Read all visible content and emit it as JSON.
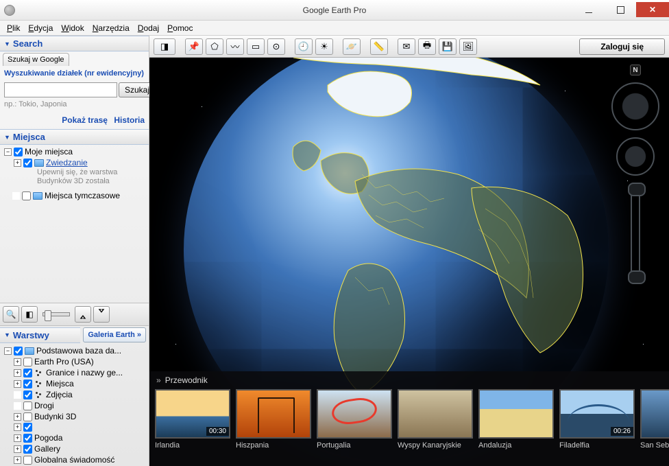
{
  "window": {
    "title": "Google Earth Pro"
  },
  "menu": {
    "file": "Plik",
    "edit": "Edycja",
    "view": "Widok",
    "tools": "Narzędzia",
    "add": "Dodaj",
    "help": "Pomoc"
  },
  "toolbar": {
    "login": "Zaloguj się"
  },
  "search": {
    "header": "Search",
    "tab_google": "Szukaj w Google",
    "tab_parcels": "Wyszukiwanie działek (nr ewidencyjny)",
    "button": "Szukaj",
    "hint": "np.: Tokio, Japonia",
    "route": "Pokaż trasę",
    "history": "Historia",
    "value": ""
  },
  "places": {
    "header": "Miejsca",
    "my_places": "Moje miejsca",
    "sightseeing": "Zwiedzanie",
    "note1": "Upewnij się, że warstwa",
    "note2": "Budynków 3D została",
    "temp": "Miejsca tymczasowe"
  },
  "layers": {
    "header": "Warstwy",
    "gallery_btn": "Galeria Earth »",
    "items": [
      {
        "label": "Podstawowa baza da...",
        "checked": true,
        "icon": "folder",
        "exp": "minus",
        "indent": 0
      },
      {
        "label": "Earth Pro (USA)",
        "checked": false,
        "icon": "none",
        "exp": "plus",
        "indent": 1
      },
      {
        "label": "Granice i nazwy ge...",
        "checked": true,
        "icon": "dots",
        "exp": "plus",
        "indent": 1
      },
      {
        "label": "Miejsca",
        "checked": true,
        "icon": "dots",
        "exp": "plus",
        "indent": 1
      },
      {
        "label": "Zdjęcia",
        "checked": true,
        "icon": "dots",
        "exp": "blank",
        "indent": 1
      },
      {
        "label": "Drogi",
        "checked": false,
        "icon": "none",
        "exp": "blank",
        "indent": 1
      },
      {
        "label": "Budynki 3D",
        "checked": false,
        "icon": "none",
        "exp": "plus",
        "indent": 1
      },
      {
        "label": "",
        "checked": true,
        "icon": "none",
        "exp": "plus",
        "indent": 1
      },
      {
        "label": "Pogoda",
        "checked": true,
        "icon": "none",
        "exp": "plus",
        "indent": 1
      },
      {
        "label": "Gallery",
        "checked": true,
        "icon": "none",
        "exp": "plus",
        "indent": 1
      },
      {
        "label": "Globalna świadomość",
        "checked": false,
        "icon": "none",
        "exp": "plus",
        "indent": 1
      }
    ]
  },
  "nav": {
    "north": "N"
  },
  "tour": {
    "header": "Przewodnik",
    "items": [
      {
        "label": "Irlandia",
        "dur": "00:30"
      },
      {
        "label": "Hiszpania",
        "dur": ""
      },
      {
        "label": "Portugalia",
        "dur": ""
      },
      {
        "label": "Wyspy Kanaryjskie",
        "dur": ""
      },
      {
        "label": "Andaluzja",
        "dur": ""
      },
      {
        "label": "Filadelfia",
        "dur": "00:26"
      },
      {
        "label": "San Sebastián",
        "dur": ""
      }
    ]
  }
}
